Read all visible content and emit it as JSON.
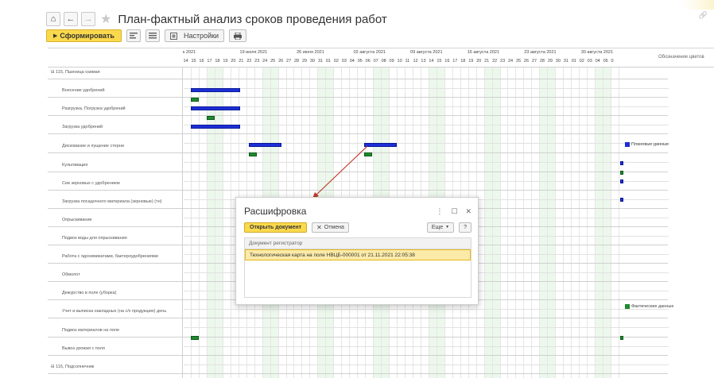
{
  "window": {
    "title": "План-фактный анализ сроков проведения работ",
    "nav_back": "←",
    "nav_forward": "→",
    "home": "⌂",
    "star": "★",
    "link": "🔗"
  },
  "toolbar": {
    "generate_label": "Сформировать",
    "settings_label": "Настройки"
  },
  "report": {
    "week_headers": [
      "к 2021",
      "19 июля 2021",
      "26 июля 2021",
      "02 августа 2021",
      "09 августа 2021",
      "16 августа 2021",
      "23 августа 2021",
      "30 августа 2021"
    ],
    "day_headers": [
      "14",
      "15",
      "16",
      "17",
      "18",
      "19",
      "20",
      "21",
      "22",
      "23",
      "24",
      "25",
      "26",
      "27",
      "28",
      "29",
      "30",
      "31",
      "01",
      "02",
      "03",
      "04",
      "05",
      "06",
      "07",
      "08",
      "09",
      "10",
      "11",
      "12",
      "13",
      "14",
      "15",
      "16",
      "17",
      "18",
      "19",
      "20",
      "21",
      "22",
      "23",
      "24",
      "25",
      "26",
      "27",
      "28",
      "29",
      "30",
      "31",
      "01",
      "02",
      "03",
      "04",
      "05",
      "0"
    ],
    "legend_title": "Обозначение цветов",
    "rows": [
      {
        "label": "115, Пшеница озимая",
        "group": true
      },
      {
        "label": "Внесение удобрений",
        "group": false
      },
      {
        "label": "Разгрузка, Погрузка удобрений",
        "group": false
      },
      {
        "label": "Загрузка удобрений",
        "group": false
      },
      {
        "label": "Дискование и лущение стерни",
        "group": false
      },
      {
        "label": "Культивация",
        "group": false
      },
      {
        "label": "Сев зерновых с удобрением",
        "group": false
      },
      {
        "label": "Загрузка посадочного материала (зерновые) (тн)",
        "group": false
      },
      {
        "label": "Опрыскивание",
        "group": false
      },
      {
        "label": "Подвоз воды для опрыскивания",
        "group": false
      },
      {
        "label": "Работа с ядохимикатами, бактероудобрениями",
        "group": false
      },
      {
        "label": "Обмолот",
        "group": false
      },
      {
        "label": "Дежурство в поле (уборка)",
        "group": false
      },
      {
        "label": "Учет и выписка накладных (на с/х продукцию) день",
        "group": false
      },
      {
        "label": "Подвоз материалов на поле",
        "group": false
      },
      {
        "label": "Вывоз урожая с поля",
        "group": false
      },
      {
        "label": "115, Подсолнечник",
        "group": true
      }
    ],
    "legend_plan": "Плановые данные",
    "legend_fact": "Фактические данные",
    "colors": {
      "plan": "#1c2fd6",
      "fact": "#1f8a30"
    }
  },
  "dialog": {
    "title": "Расшифровка",
    "ctrl_more": "⋮",
    "ctrl_max": "☐",
    "ctrl_close": "✕",
    "open_label": "Открыть документ",
    "cancel_label": "Отмена",
    "more_label": "Еще",
    "help_label": "?",
    "column_header": "Документ регистратор",
    "row_value": "Технологическая карта на поле НВЦБ-000001 от 21.11.2021 22:05:38"
  }
}
